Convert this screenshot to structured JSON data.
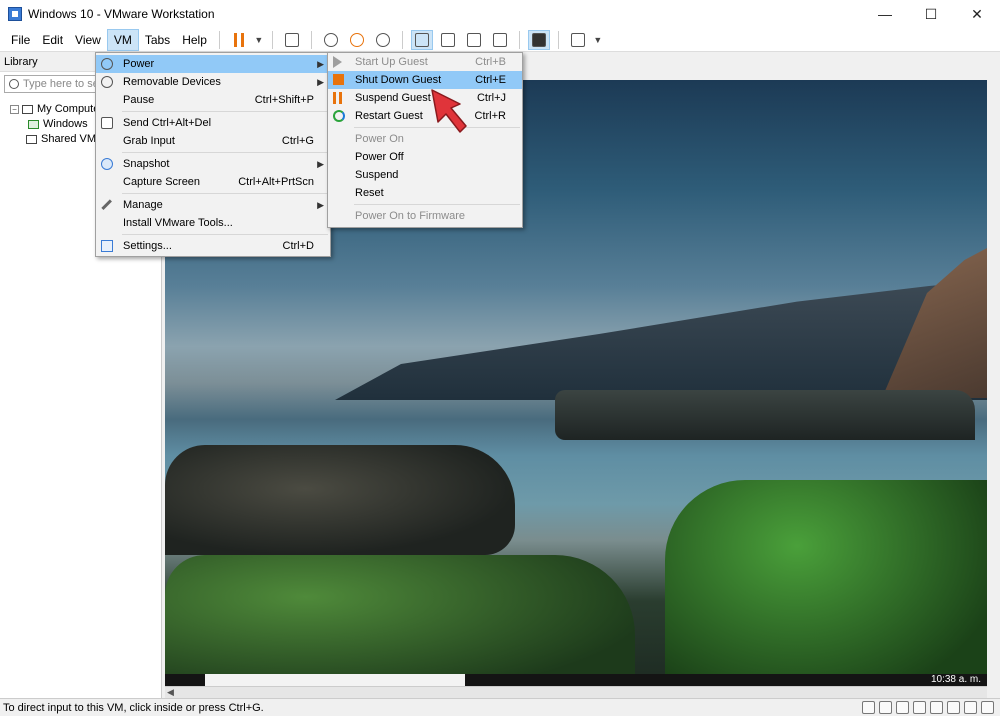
{
  "window": {
    "title": "Windows 10 - VMware Workstation",
    "minimize": "—",
    "maximize": "☐",
    "close": "✕"
  },
  "menubar": {
    "file": "File",
    "edit": "Edit",
    "view": "View",
    "vm": "VM",
    "tabs": "Tabs",
    "help": "Help"
  },
  "library": {
    "header": "Library",
    "search_placeholder": "Type here to se",
    "tree": {
      "my_computer": "My Compute",
      "windows_vm": "Windows",
      "shared_vms": "Shared VMs"
    }
  },
  "vm_menu": {
    "power": "Power",
    "removable_devices": "Removable Devices",
    "pause": "Pause",
    "pause_shortcut": "Ctrl+Shift+P",
    "send_cad": "Send Ctrl+Alt+Del",
    "grab_input": "Grab Input",
    "grab_input_shortcut": "Ctrl+G",
    "snapshot": "Snapshot",
    "capture_screen": "Capture Screen",
    "capture_screen_shortcut": "Ctrl+Alt+PrtScn",
    "manage": "Manage",
    "install_tools": "Install VMware Tools...",
    "settings": "Settings...",
    "settings_shortcut": "Ctrl+D"
  },
  "power_menu": {
    "start_up_guest": "Start Up Guest",
    "start_up_guest_shortcut": "Ctrl+B",
    "shut_down_guest": "Shut Down Guest",
    "shut_down_guest_shortcut": "Ctrl+E",
    "suspend_guest": "Suspend Guest",
    "suspend_guest_shortcut": "Ctrl+J",
    "restart_guest": "Restart Guest",
    "restart_guest_shortcut": "Ctrl+R",
    "power_on": "Power On",
    "power_off": "Power Off",
    "suspend": "Suspend",
    "reset": "Reset",
    "power_on_firmware": "Power On to Firmware"
  },
  "guest": {
    "clock": "10:38 a. m."
  },
  "statusbar": {
    "text": "To direct input to this VM, click inside or press Ctrl+G."
  },
  "colors": {
    "highlight": "#91c9f7",
    "accent_orange": "#e8730c",
    "pointer_red": "#e0343a"
  }
}
